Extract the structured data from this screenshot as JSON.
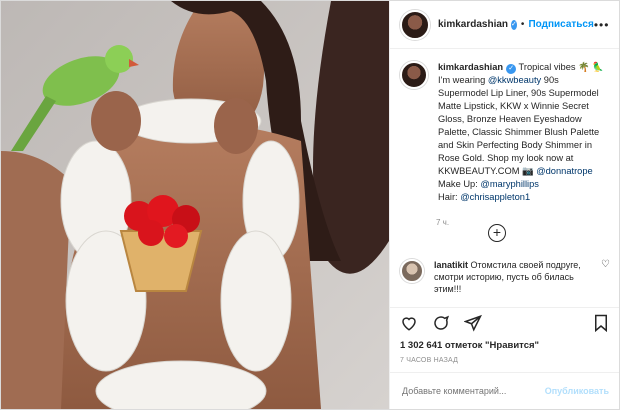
{
  "header": {
    "username": "kimkardashian",
    "separator": "•",
    "follow_label": "Подписаться",
    "more_label": "•••"
  },
  "caption": {
    "username": "kimkardashian",
    "intro": " Tropical vibes 🌴 🦜",
    "line1": "I'm wearing ",
    "mention1": "@kkwbeauty",
    "line2": " 90s Supermodel Lip Liner, 90s Supermodel Matte Lipstick, KKW x Winnie Secret Gloss, Bronze Heaven Eyeshadow Palette, Classic Shimmer Blush Palette and Skin Perfecting Body Shimmer in Rose Gold. Shop my look now at KKWBEAUTY.COM 📷 ",
    "mention2": "@donnatrope",
    "line3": "Make Up: ",
    "mention3": "@maryphillips",
    "line4": "Hair: ",
    "mention4": "@chrisappleton1",
    "time": "7 ч."
  },
  "comment": {
    "username": "lanatikit",
    "text": " Отомстила своей подруге, смотри историю, пусть об билась этим!!!"
  },
  "likes": "1 302 641 отметок \"Нравится\"",
  "ago": "7 часов назад",
  "add_comment": {
    "placeholder": "Добавьте комментарий...",
    "publish": "Опубликовать"
  },
  "icons": [
    "heart-icon",
    "comment-icon",
    "share-icon",
    "bookmark-icon",
    "plus-circle-icon",
    "verified-icon"
  ],
  "colors": {
    "accent": "#0095f6",
    "publish_disabled": "#b2dffc",
    "text": "#262626",
    "muted": "#8e8e8e"
  }
}
